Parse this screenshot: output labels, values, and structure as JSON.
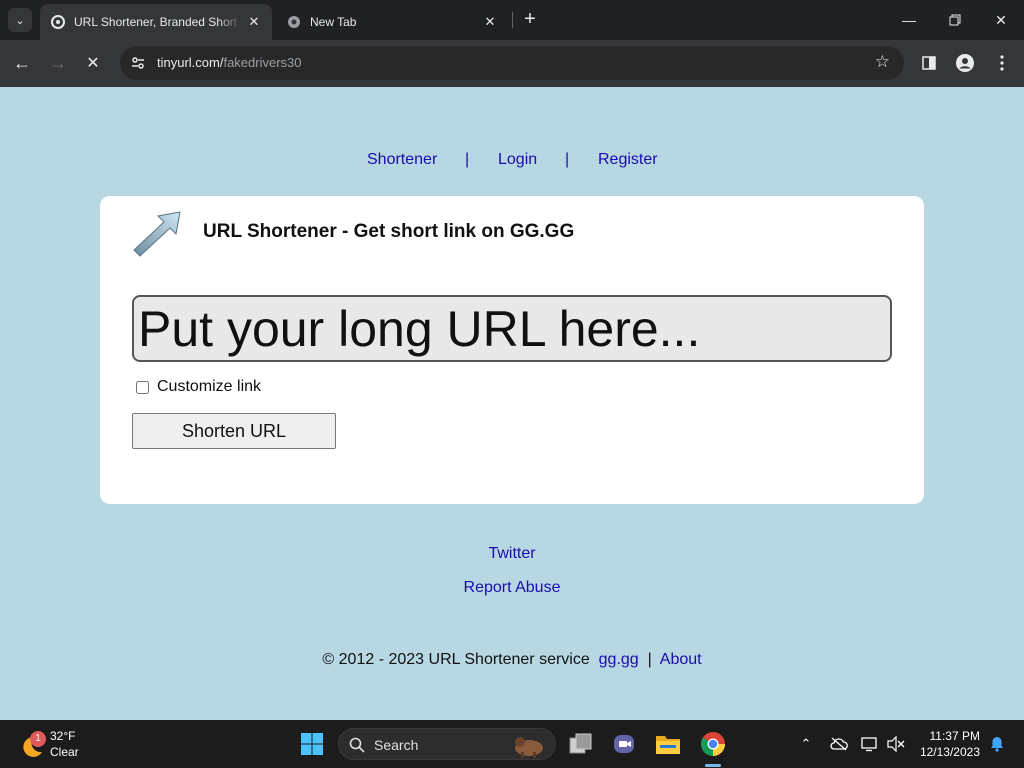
{
  "browser": {
    "tabs": [
      {
        "title": "URL Shortener, Branded Short Links & Analytics | TinyURL",
        "active": true
      },
      {
        "title": "New Tab",
        "active": false
      }
    ],
    "url_host": "tinyurl.com/",
    "url_path": "fakedrivers30"
  },
  "nav": {
    "shortener": "Shortener",
    "separator": "|",
    "login": "Login",
    "register": "Register"
  },
  "card": {
    "heading": "URL Shortener - Get short link on GG.GG",
    "url_placeholder": "Put your long URL here...",
    "customize_label": "Customize link",
    "shorten_button": "Shorten URL"
  },
  "footer": {
    "twitter": "Twitter",
    "report_abuse": "Report Abuse",
    "copyright": "© 2012 - 2023 URL Shortener service",
    "site_link": "gg.gg",
    "separator": "|",
    "about": "About"
  },
  "taskbar": {
    "weather_temp": "32°F",
    "weather_condition": "Clear",
    "weather_badge": "1",
    "search_label": "Search",
    "time": "11:37 PM",
    "date": "12/13/2023"
  },
  "colors": {
    "page_background": "#b7d7e3",
    "link": "#1a0dab",
    "card": "#ffffff"
  }
}
